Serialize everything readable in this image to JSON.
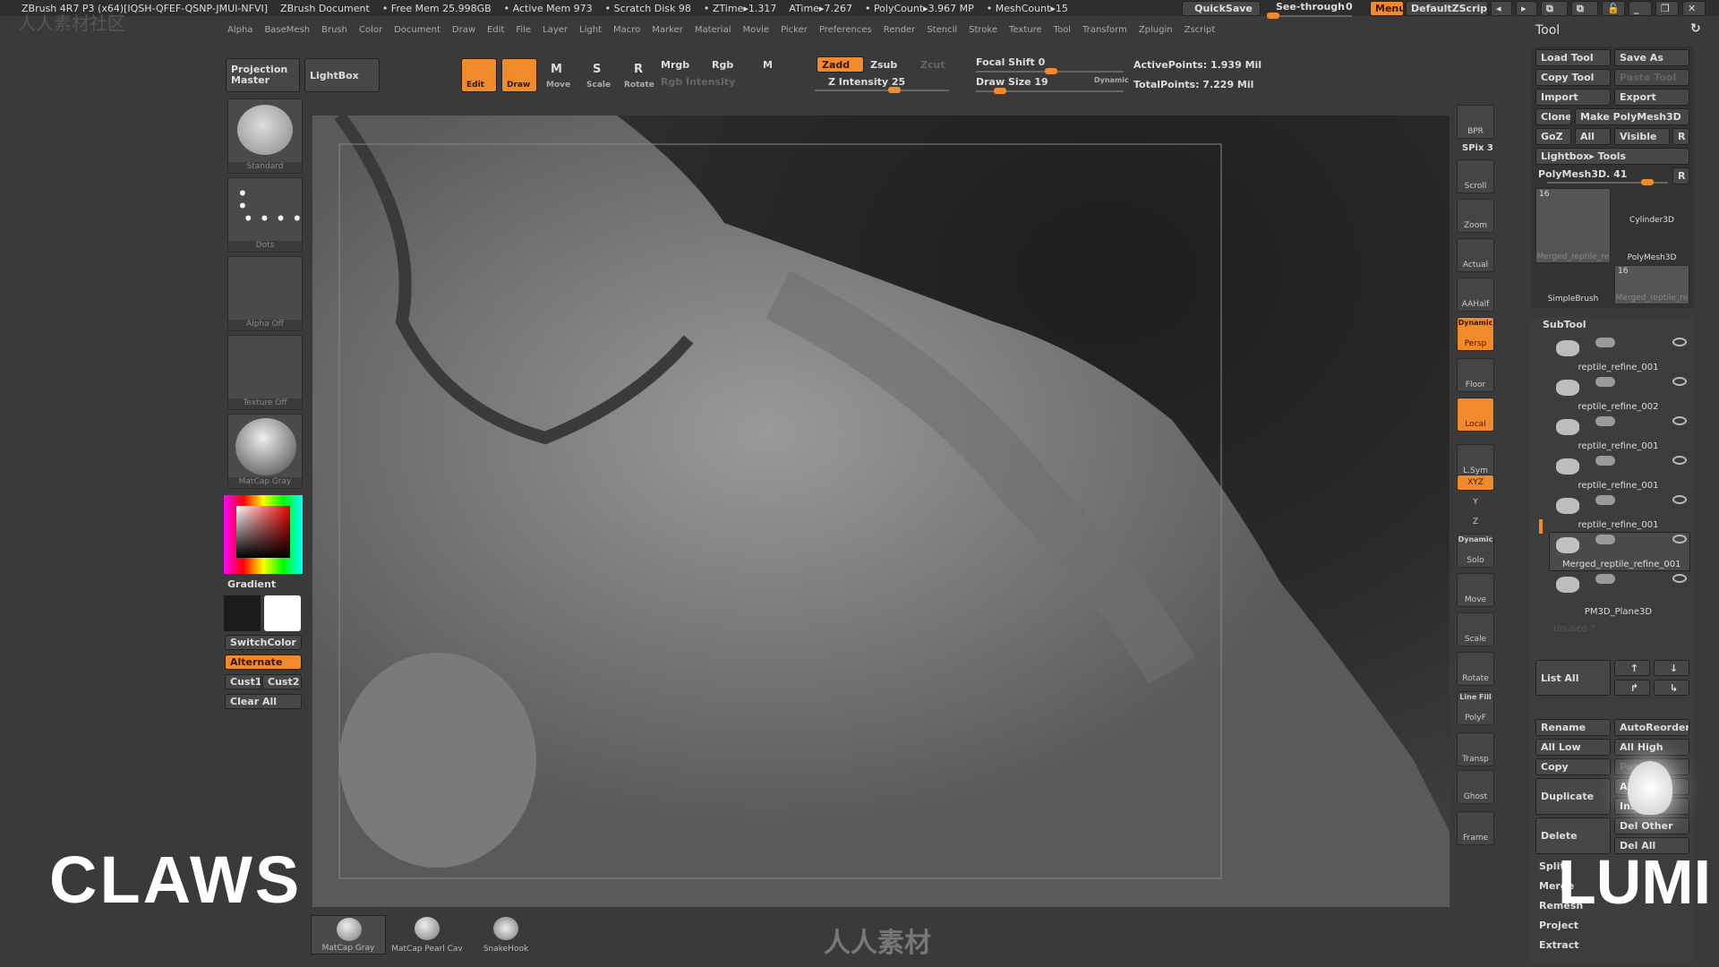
{
  "titlebar": {
    "app": "ZBrush 4R7 P3 (x64)[IQSH-QFEF-QSNP-JMUI-NFVI]",
    "doc": "ZBrush Document",
    "free_mem": "• Free Mem 25.998GB",
    "active_mem": "• Active Mem 973",
    "scratch": "• Scratch Disk 98",
    "ztime": "• ZTime▸1.317",
    "atime": "ATime▸7.267",
    "polycount": "• PolyCount▸3.967 MP",
    "meshcount": "• MeshCount▸15",
    "quicksave": "QuickSave",
    "see_through": "See-through",
    "see_through_value": "0",
    "menus": "Menus",
    "zscript": "DefaultZScript"
  },
  "menu": [
    "Alpha",
    "BaseMesh",
    "Brush",
    "Color",
    "Document",
    "Draw",
    "Edit",
    "File",
    "Layer",
    "Light",
    "Macro",
    "Marker",
    "Material",
    "Movie",
    "Picker",
    "Preferences",
    "Render",
    "Stencil",
    "Stroke",
    "Texture",
    "Tool",
    "Transform",
    "Zplugin",
    "Zscript"
  ],
  "toolbar": {
    "projection_master": "Projection Master",
    "lightbox": "LightBox",
    "edit": "Edit",
    "draw": "Draw",
    "move": "Move",
    "scale": "Scale",
    "rotate": "Rotate",
    "mrgb": "Mrgb",
    "rgb": "Rgb",
    "m": "M",
    "rgb_intensity": "Rgb Intensity",
    "zadd": "Zadd",
    "zsub": "Zsub",
    "zcut": "Zcut",
    "z_intensity": "Z Intensity 25",
    "focal_shift": "Focal Shift 0",
    "draw_size": "Draw Size 19",
    "dynamic": "Dynamic",
    "active_points": "ActivePoints: 1.939 Mil",
    "total_points": "TotalPoints: 7.229 Mil",
    "z_intensity_value": 25,
    "focal_shift_value": 0,
    "draw_size_value": 19
  },
  "left": {
    "brush": "Standard",
    "stroke": "Dots",
    "alpha": "Alpha Off",
    "texture": "Texture Off",
    "material": "MatCap Gray",
    "gradient": "Gradient",
    "switch_color": "SwitchColor",
    "alternate": "Alternate",
    "cust1": "Cust1",
    "cust2": "Cust2",
    "clear_all": "Clear All"
  },
  "shelf": [
    {
      "label": "BPR"
    },
    {
      "label": "SPix 3"
    },
    {
      "label": "Scroll"
    },
    {
      "label": "Zoom"
    },
    {
      "label": "Actual"
    },
    {
      "label": "AAHalf"
    },
    {
      "label": "Persp",
      "top": "Dynamic",
      "active": true
    },
    {
      "label": "Floor"
    },
    {
      "label": "Local",
      "active": true
    },
    {
      "label": "L.Sym"
    },
    {
      "label": "XYZ",
      "active": true
    },
    {
      "label": "Y"
    },
    {
      "label": "Z"
    },
    {
      "label": "Solo",
      "top": "Dynamic"
    },
    {
      "label": "Move"
    },
    {
      "label": "Scale"
    },
    {
      "label": "Rotate"
    },
    {
      "label": "PolyF",
      "top": "Line Fill"
    },
    {
      "label": "Transp"
    },
    {
      "label": "Ghost"
    },
    {
      "label": "Frame"
    }
  ],
  "tool": {
    "title": "Tool",
    "load": "Load Tool",
    "save_as": "Save As",
    "copy": "Copy Tool",
    "paste": "Paste Tool",
    "import": "Import",
    "export": "Export",
    "clone": "Clone",
    "make_polymesh": "Make PolyMesh3D",
    "goz": "GoZ",
    "all": "All",
    "visible": "Visible",
    "r": "R",
    "lightbox_tools": "Lightbox▸ Tools",
    "current": "PolyMesh3D. 41",
    "thumbs": [
      {
        "name": "Merged_reptile_re",
        "count": "16"
      },
      {
        "name": "Cylinder3D"
      },
      {
        "name": "PolyMesh3D"
      },
      {
        "name": "SimpleBrush"
      },
      {
        "name": "Merged_reptile_re",
        "count": "16"
      }
    ]
  },
  "subtool": {
    "title": "SubTool",
    "items": [
      "reptile_refine_001",
      "reptile_refine_002",
      "reptile_refine_001",
      "reptile_refine_001",
      "reptile_refine_001",
      "Merged_reptile_refine_001",
      "PM3D_Plane3D"
    ],
    "selected": "Merged_reptile_refine_001",
    "unused": "Unused 7",
    "list_all": "List All",
    "rename": "Rename",
    "autoreorder": "AutoReorder",
    "all_low": "All Low",
    "all_high": "All High",
    "copy": "Copy",
    "paste": "Paste",
    "duplicate": "Duplicate",
    "append": "Append",
    "insert": "Insert",
    "delete": "Delete",
    "del_other": "Del Other",
    "del_all": "Del All",
    "split": "Split",
    "merge": "Merge",
    "remesh": "Remesh",
    "project": "Project",
    "extract": "Extract"
  },
  "bottom": {
    "materials": [
      "MatCap Gray",
      "MatCap Pearl Cav",
      "SnakeHook"
    ]
  },
  "overlay": {
    "left_caption": "CLAWS",
    "right_logo": "LUMI",
    "watermark": "人人素材",
    "watermark_top": "人人素材社区"
  },
  "colors": {
    "accent": "#f08a2a",
    "panel": "#3a3a3a",
    "button": "#474747"
  }
}
